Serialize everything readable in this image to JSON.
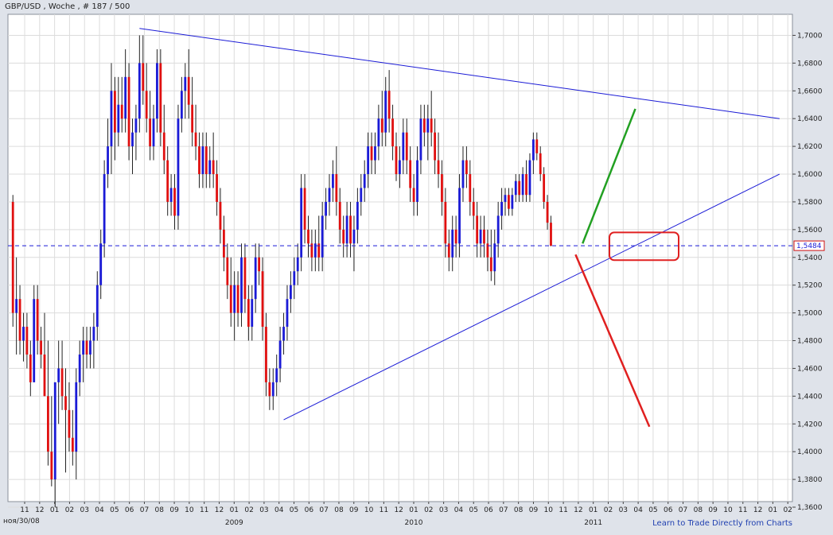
{
  "header": {
    "symbol": "GBP/USD",
    "title_text": "GBP/USD , Woche , # 187 / 500"
  },
  "footer": {
    "start_label": "ноя/30/08",
    "link_text": "Learn to Trade Directly from Charts"
  },
  "colors": {
    "background": "#ffffff",
    "frame": "#dfe3ea",
    "grid": "#dcdcdc",
    "bull_candle": "#1a1ad6",
    "bear_candle": "#e01010",
    "trendline": "#1a1ad6",
    "price_line": "#1a1ad6",
    "green_arrow": "#22a022",
    "red_arrow": "#e02020",
    "highlight_box": "#e02020"
  },
  "chart_data": {
    "type": "candlestick",
    "title": "GBP/USD , Woche , # 187 / 500",
    "timeframe": "weekly",
    "grid": true,
    "ylim": [
      1.36,
      1.71
    ],
    "y_ticks": [
      "1,7000",
      "1,6800",
      "1,6600",
      "1,6400",
      "1,6200",
      "1,6000",
      "1,5800",
      "1,5600",
      "1,5400",
      "1,5200",
      "1,5000",
      "1,4800",
      "1,4600",
      "1,4400",
      "1,4200",
      "1,4000",
      "1,3800",
      "1,3600"
    ],
    "x_ticks": [
      "11",
      "12",
      "01",
      "02",
      "03",
      "04",
      "05",
      "06",
      "07",
      "08",
      "09",
      "10",
      "11",
      "12",
      "01",
      "02",
      "03",
      "04",
      "05",
      "06",
      "07",
      "08",
      "09",
      "10",
      "11",
      "12",
      "01",
      "02",
      "03",
      "04",
      "05",
      "06",
      "07",
      "08",
      "09",
      "10",
      "11",
      "12",
      "01",
      "02",
      "03",
      "04",
      "05",
      "06",
      "07",
      "08",
      "09",
      "10",
      "11",
      "12",
      "01",
      "02"
    ],
    "year_labels": [
      {
        "label": "2009",
        "tick_index": 14
      },
      {
        "label": "2010",
        "tick_index": 26
      },
      {
        "label": "2011",
        "tick_index": 38
      }
    ],
    "current_price": 1.5484,
    "current_price_label": "1,5484",
    "candles": [
      {
        "o": 1.58,
        "h": 1.585,
        "l": 1.49,
        "c": 1.5
      },
      {
        "o": 1.5,
        "h": 1.54,
        "l": 1.47,
        "c": 1.51
      },
      {
        "o": 1.51,
        "h": 1.52,
        "l": 1.47,
        "c": 1.48
      },
      {
        "o": 1.48,
        "h": 1.5,
        "l": 1.465,
        "c": 1.49
      },
      {
        "o": 1.49,
        "h": 1.5,
        "l": 1.46,
        "c": 1.47
      },
      {
        "o": 1.47,
        "h": 1.48,
        "l": 1.44,
        "c": 1.45
      },
      {
        "o": 1.45,
        "h": 1.52,
        "l": 1.45,
        "c": 1.51
      },
      {
        "o": 1.51,
        "h": 1.52,
        "l": 1.47,
        "c": 1.48
      },
      {
        "o": 1.48,
        "h": 1.49,
        "l": 1.46,
        "c": 1.47
      },
      {
        "o": 1.47,
        "h": 1.5,
        "l": 1.44,
        "c": 1.44
      },
      {
        "o": 1.44,
        "h": 1.48,
        "l": 1.39,
        "c": 1.4
      },
      {
        "o": 1.4,
        "h": 1.44,
        "l": 1.375,
        "c": 1.38
      },
      {
        "o": 1.38,
        "h": 1.45,
        "l": 1.36,
        "c": 1.45
      },
      {
        "o": 1.45,
        "h": 1.48,
        "l": 1.42,
        "c": 1.46
      },
      {
        "o": 1.46,
        "h": 1.48,
        "l": 1.43,
        "c": 1.44
      },
      {
        "o": 1.44,
        "h": 1.46,
        "l": 1.385,
        "c": 1.43
      },
      {
        "o": 1.43,
        "h": 1.45,
        "l": 1.4,
        "c": 1.41
      },
      {
        "o": 1.41,
        "h": 1.43,
        "l": 1.39,
        "c": 1.4
      },
      {
        "o": 1.4,
        "h": 1.46,
        "l": 1.38,
        "c": 1.45
      },
      {
        "o": 1.45,
        "h": 1.48,
        "l": 1.44,
        "c": 1.47
      },
      {
        "o": 1.47,
        "h": 1.49,
        "l": 1.45,
        "c": 1.48
      },
      {
        "o": 1.48,
        "h": 1.49,
        "l": 1.46,
        "c": 1.47
      },
      {
        "o": 1.47,
        "h": 1.49,
        "l": 1.46,
        "c": 1.48
      },
      {
        "o": 1.48,
        "h": 1.5,
        "l": 1.46,
        "c": 1.49
      },
      {
        "o": 1.49,
        "h": 1.53,
        "l": 1.48,
        "c": 1.52
      },
      {
        "o": 1.52,
        "h": 1.56,
        "l": 1.51,
        "c": 1.55
      },
      {
        "o": 1.55,
        "h": 1.61,
        "l": 1.54,
        "c": 1.6
      },
      {
        "o": 1.6,
        "h": 1.64,
        "l": 1.59,
        "c": 1.62
      },
      {
        "o": 1.62,
        "h": 1.68,
        "l": 1.6,
        "c": 1.66
      },
      {
        "o": 1.66,
        "h": 1.67,
        "l": 1.61,
        "c": 1.63
      },
      {
        "o": 1.63,
        "h": 1.67,
        "l": 1.62,
        "c": 1.65
      },
      {
        "o": 1.65,
        "h": 1.67,
        "l": 1.63,
        "c": 1.64
      },
      {
        "o": 1.64,
        "h": 1.69,
        "l": 1.63,
        "c": 1.67
      },
      {
        "o": 1.67,
        "h": 1.68,
        "l": 1.61,
        "c": 1.62
      },
      {
        "o": 1.62,
        "h": 1.64,
        "l": 1.6,
        "c": 1.63
      },
      {
        "o": 1.63,
        "h": 1.65,
        "l": 1.61,
        "c": 1.64
      },
      {
        "o": 1.64,
        "h": 1.7,
        "l": 1.63,
        "c": 1.68
      },
      {
        "o": 1.68,
        "h": 1.7,
        "l": 1.65,
        "c": 1.66
      },
      {
        "o": 1.66,
        "h": 1.68,
        "l": 1.63,
        "c": 1.64
      },
      {
        "o": 1.64,
        "h": 1.66,
        "l": 1.61,
        "c": 1.62
      },
      {
        "o": 1.62,
        "h": 1.65,
        "l": 1.61,
        "c": 1.64
      },
      {
        "o": 1.64,
        "h": 1.69,
        "l": 1.63,
        "c": 1.68
      },
      {
        "o": 1.68,
        "h": 1.69,
        "l": 1.62,
        "c": 1.63
      },
      {
        "o": 1.63,
        "h": 1.65,
        "l": 1.6,
        "c": 1.61
      },
      {
        "o": 1.61,
        "h": 1.62,
        "l": 1.57,
        "c": 1.58
      },
      {
        "o": 1.58,
        "h": 1.6,
        "l": 1.57,
        "c": 1.59
      },
      {
        "o": 1.59,
        "h": 1.6,
        "l": 1.56,
        "c": 1.57
      },
      {
        "o": 1.57,
        "h": 1.65,
        "l": 1.56,
        "c": 1.64
      },
      {
        "o": 1.64,
        "h": 1.67,
        "l": 1.63,
        "c": 1.66
      },
      {
        "o": 1.66,
        "h": 1.68,
        "l": 1.64,
        "c": 1.67
      },
      {
        "o": 1.67,
        "h": 1.69,
        "l": 1.64,
        "c": 1.65
      },
      {
        "o": 1.65,
        "h": 1.67,
        "l": 1.62,
        "c": 1.63
      },
      {
        "o": 1.63,
        "h": 1.65,
        "l": 1.61,
        "c": 1.62
      },
      {
        "o": 1.62,
        "h": 1.63,
        "l": 1.59,
        "c": 1.6
      },
      {
        "o": 1.6,
        "h": 1.63,
        "l": 1.59,
        "c": 1.62
      },
      {
        "o": 1.62,
        "h": 1.63,
        "l": 1.59,
        "c": 1.6
      },
      {
        "o": 1.6,
        "h": 1.62,
        "l": 1.59,
        "c": 1.61
      },
      {
        "o": 1.61,
        "h": 1.63,
        "l": 1.59,
        "c": 1.6
      },
      {
        "o": 1.6,
        "h": 1.61,
        "l": 1.57,
        "c": 1.58
      },
      {
        "o": 1.58,
        "h": 1.59,
        "l": 1.55,
        "c": 1.56
      },
      {
        "o": 1.56,
        "h": 1.57,
        "l": 1.53,
        "c": 1.54
      },
      {
        "o": 1.54,
        "h": 1.55,
        "l": 1.51,
        "c": 1.52
      },
      {
        "o": 1.52,
        "h": 1.54,
        "l": 1.49,
        "c": 1.5
      },
      {
        "o": 1.5,
        "h": 1.53,
        "l": 1.48,
        "c": 1.52
      },
      {
        "o": 1.52,
        "h": 1.53,
        "l": 1.49,
        "c": 1.5
      },
      {
        "o": 1.5,
        "h": 1.55,
        "l": 1.49,
        "c": 1.54
      },
      {
        "o": 1.54,
        "h": 1.55,
        "l": 1.5,
        "c": 1.51
      },
      {
        "o": 1.51,
        "h": 1.52,
        "l": 1.48,
        "c": 1.49
      },
      {
        "o": 1.49,
        "h": 1.52,
        "l": 1.48,
        "c": 1.51
      },
      {
        "o": 1.51,
        "h": 1.55,
        "l": 1.5,
        "c": 1.54
      },
      {
        "o": 1.54,
        "h": 1.55,
        "l": 1.52,
        "c": 1.53
      },
      {
        "o": 1.53,
        "h": 1.54,
        "l": 1.48,
        "c": 1.49
      },
      {
        "o": 1.49,
        "h": 1.5,
        "l": 1.44,
        "c": 1.45
      },
      {
        "o": 1.45,
        "h": 1.46,
        "l": 1.43,
        "c": 1.44
      },
      {
        "o": 1.44,
        "h": 1.46,
        "l": 1.43,
        "c": 1.45
      },
      {
        "o": 1.45,
        "h": 1.47,
        "l": 1.44,
        "c": 1.46
      },
      {
        "o": 1.46,
        "h": 1.49,
        "l": 1.45,
        "c": 1.48
      },
      {
        "o": 1.48,
        "h": 1.5,
        "l": 1.47,
        "c": 1.49
      },
      {
        "o": 1.49,
        "h": 1.52,
        "l": 1.48,
        "c": 1.51
      },
      {
        "o": 1.51,
        "h": 1.53,
        "l": 1.5,
        "c": 1.52
      },
      {
        "o": 1.52,
        "h": 1.54,
        "l": 1.51,
        "c": 1.53
      },
      {
        "o": 1.53,
        "h": 1.55,
        "l": 1.52,
        "c": 1.54
      },
      {
        "o": 1.54,
        "h": 1.6,
        "l": 1.53,
        "c": 1.59
      },
      {
        "o": 1.59,
        "h": 1.6,
        "l": 1.55,
        "c": 1.56
      },
      {
        "o": 1.56,
        "h": 1.57,
        "l": 1.54,
        "c": 1.55
      },
      {
        "o": 1.55,
        "h": 1.56,
        "l": 1.53,
        "c": 1.54
      },
      {
        "o": 1.54,
        "h": 1.56,
        "l": 1.53,
        "c": 1.55
      },
      {
        "o": 1.55,
        "h": 1.57,
        "l": 1.53,
        "c": 1.54
      },
      {
        "o": 1.54,
        "h": 1.58,
        "l": 1.53,
        "c": 1.57
      },
      {
        "o": 1.57,
        "h": 1.59,
        "l": 1.56,
        "c": 1.58
      },
      {
        "o": 1.58,
        "h": 1.6,
        "l": 1.57,
        "c": 1.59
      },
      {
        "o": 1.59,
        "h": 1.61,
        "l": 1.58,
        "c": 1.6
      },
      {
        "o": 1.6,
        "h": 1.62,
        "l": 1.57,
        "c": 1.58
      },
      {
        "o": 1.58,
        "h": 1.59,
        "l": 1.55,
        "c": 1.56
      },
      {
        "o": 1.56,
        "h": 1.57,
        "l": 1.54,
        "c": 1.55
      },
      {
        "o": 1.55,
        "h": 1.58,
        "l": 1.54,
        "c": 1.57
      },
      {
        "o": 1.57,
        "h": 1.58,
        "l": 1.54,
        "c": 1.55
      },
      {
        "o": 1.55,
        "h": 1.57,
        "l": 1.53,
        "c": 1.56
      },
      {
        "o": 1.56,
        "h": 1.59,
        "l": 1.55,
        "c": 1.58
      },
      {
        "o": 1.58,
        "h": 1.6,
        "l": 1.57,
        "c": 1.59
      },
      {
        "o": 1.59,
        "h": 1.61,
        "l": 1.58,
        "c": 1.6
      },
      {
        "o": 1.6,
        "h": 1.63,
        "l": 1.59,
        "c": 1.62
      },
      {
        "o": 1.62,
        "h": 1.63,
        "l": 1.6,
        "c": 1.61
      },
      {
        "o": 1.61,
        "h": 1.63,
        "l": 1.6,
        "c": 1.62
      },
      {
        "o": 1.62,
        "h": 1.65,
        "l": 1.61,
        "c": 1.64
      },
      {
        "o": 1.64,
        "h": 1.66,
        "l": 1.62,
        "c": 1.63
      },
      {
        "o": 1.63,
        "h": 1.67,
        "l": 1.62,
        "c": 1.66
      },
      {
        "o": 1.66,
        "h": 1.675,
        "l": 1.63,
        "c": 1.64
      },
      {
        "o": 1.64,
        "h": 1.65,
        "l": 1.61,
        "c": 1.62
      },
      {
        "o": 1.62,
        "h": 1.63,
        "l": 1.595,
        "c": 1.6
      },
      {
        "o": 1.6,
        "h": 1.62,
        "l": 1.59,
        "c": 1.61
      },
      {
        "o": 1.61,
        "h": 1.64,
        "l": 1.6,
        "c": 1.63
      },
      {
        "o": 1.63,
        "h": 1.64,
        "l": 1.6,
        "c": 1.61
      },
      {
        "o": 1.61,
        "h": 1.62,
        "l": 1.58,
        "c": 1.59
      },
      {
        "o": 1.59,
        "h": 1.6,
        "l": 1.57,
        "c": 1.58
      },
      {
        "o": 1.58,
        "h": 1.62,
        "l": 1.57,
        "c": 1.61
      },
      {
        "o": 1.61,
        "h": 1.65,
        "l": 1.6,
        "c": 1.64
      },
      {
        "o": 1.64,
        "h": 1.65,
        "l": 1.62,
        "c": 1.63
      },
      {
        "o": 1.63,
        "h": 1.65,
        "l": 1.61,
        "c": 1.64
      },
      {
        "o": 1.64,
        "h": 1.66,
        "l": 1.62,
        "c": 1.63
      },
      {
        "o": 1.63,
        "h": 1.64,
        "l": 1.6,
        "c": 1.61
      },
      {
        "o": 1.61,
        "h": 1.63,
        "l": 1.59,
        "c": 1.6
      },
      {
        "o": 1.6,
        "h": 1.61,
        "l": 1.57,
        "c": 1.58
      },
      {
        "o": 1.58,
        "h": 1.59,
        "l": 1.54,
        "c": 1.55
      },
      {
        "o": 1.55,
        "h": 1.56,
        "l": 1.53,
        "c": 1.54
      },
      {
        "o": 1.54,
        "h": 1.57,
        "l": 1.53,
        "c": 1.56
      },
      {
        "o": 1.56,
        "h": 1.57,
        "l": 1.54,
        "c": 1.55
      },
      {
        "o": 1.55,
        "h": 1.6,
        "l": 1.54,
        "c": 1.59
      },
      {
        "o": 1.59,
        "h": 1.62,
        "l": 1.58,
        "c": 1.61
      },
      {
        "o": 1.61,
        "h": 1.62,
        "l": 1.59,
        "c": 1.6
      },
      {
        "o": 1.6,
        "h": 1.61,
        "l": 1.57,
        "c": 1.58
      },
      {
        "o": 1.58,
        "h": 1.59,
        "l": 1.56,
        "c": 1.57
      },
      {
        "o": 1.57,
        "h": 1.58,
        "l": 1.54,
        "c": 1.55
      },
      {
        "o": 1.55,
        "h": 1.57,
        "l": 1.54,
        "c": 1.56
      },
      {
        "o": 1.56,
        "h": 1.57,
        "l": 1.54,
        "c": 1.55
      },
      {
        "o": 1.55,
        "h": 1.56,
        "l": 1.53,
        "c": 1.54
      },
      {
        "o": 1.54,
        "h": 1.56,
        "l": 1.523,
        "c": 1.53
      },
      {
        "o": 1.53,
        "h": 1.56,
        "l": 1.52,
        "c": 1.55
      },
      {
        "o": 1.55,
        "h": 1.58,
        "l": 1.54,
        "c": 1.57
      },
      {
        "o": 1.57,
        "h": 1.59,
        "l": 1.56,
        "c": 1.58
      },
      {
        "o": 1.58,
        "h": 1.59,
        "l": 1.57,
        "c": 1.585
      },
      {
        "o": 1.585,
        "h": 1.59,
        "l": 1.57,
        "c": 1.575
      },
      {
        "o": 1.575,
        "h": 1.59,
        "l": 1.57,
        "c": 1.585
      },
      {
        "o": 1.585,
        "h": 1.6,
        "l": 1.58,
        "c": 1.595
      },
      {
        "o": 1.595,
        "h": 1.6,
        "l": 1.58,
        "c": 1.585
      },
      {
        "o": 1.585,
        "h": 1.605,
        "l": 1.58,
        "c": 1.6
      },
      {
        "o": 1.6,
        "h": 1.61,
        "l": 1.58,
        "c": 1.585
      },
      {
        "o": 1.585,
        "h": 1.615,
        "l": 1.58,
        "c": 1.61
      },
      {
        "o": 1.61,
        "h": 1.63,
        "l": 1.6,
        "c": 1.625
      },
      {
        "o": 1.625,
        "h": 1.63,
        "l": 1.61,
        "c": 1.615
      },
      {
        "o": 1.615,
        "h": 1.62,
        "l": 1.595,
        "c": 1.6
      },
      {
        "o": 1.6,
        "h": 1.605,
        "l": 1.575,
        "c": 1.58
      },
      {
        "o": 1.58,
        "h": 1.585,
        "l": 1.56,
        "c": 1.565
      },
      {
        "o": 1.565,
        "h": 1.57,
        "l": 1.548,
        "c": 1.5484
      }
    ],
    "annotations": [
      {
        "type": "trendline",
        "name": "upper-resistance",
        "points": [
          {
            "bar": 36,
            "price": 1.705
          },
          {
            "bar": 218,
            "price": 1.64
          }
        ]
      },
      {
        "type": "trendline",
        "name": "lower-support",
        "points": [
          {
            "bar": 77,
            "price": 1.423
          },
          {
            "bar": 218,
            "price": 1.6
          }
        ]
      },
      {
        "type": "arrow-line",
        "name": "bullish-scenario",
        "color": "green",
        "points": [
          {
            "bar": 162,
            "price": 1.55
          },
          {
            "bar": 177,
            "price": 1.647
          }
        ]
      },
      {
        "type": "arrow-line",
        "name": "bearish-scenario",
        "color": "red",
        "points": [
          {
            "bar": 160,
            "price": 1.542
          },
          {
            "bar": 181,
            "price": 1.418
          }
        ]
      },
      {
        "type": "highlight-box",
        "name": "breakout-zone",
        "price_range": [
          1.538,
          1.558
        ]
      }
    ]
  }
}
